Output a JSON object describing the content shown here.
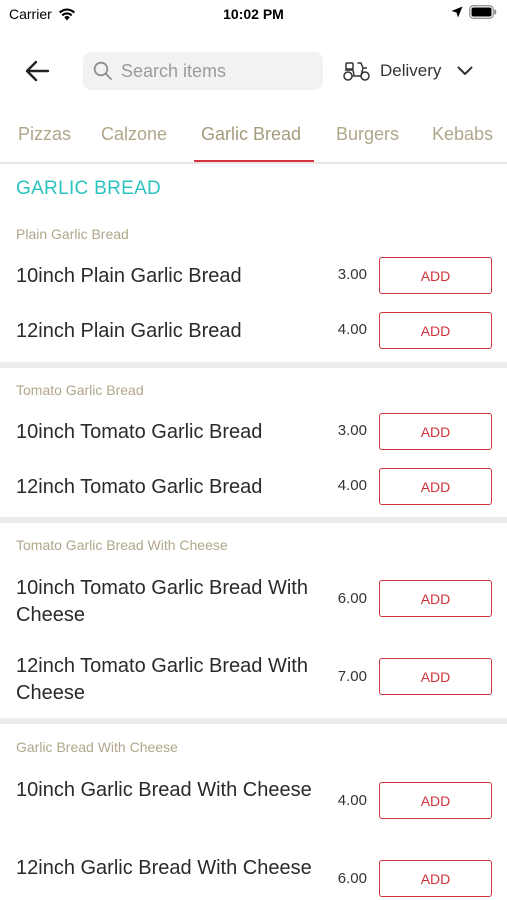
{
  "status_bar": {
    "carrier": "Carrier",
    "time": "10:02 PM"
  },
  "header": {
    "search_placeholder": "Search items",
    "delivery_label": "Delivery"
  },
  "tabs": [
    {
      "label": "Pizzas"
    },
    {
      "label": "Calzone"
    },
    {
      "label": "Garlic Bread",
      "active": true
    },
    {
      "label": "Burgers"
    },
    {
      "label": "Kebabs"
    }
  ],
  "section": {
    "title": "GARLIC BREAD"
  },
  "groups": [
    {
      "title": "Plain Garlic Bread",
      "items": [
        {
          "name": "10inch Plain Garlic Bread",
          "price": "3.00",
          "button": "ADD"
        },
        {
          "name": "12inch Plain Garlic Bread",
          "price": "4.00",
          "button": "ADD"
        }
      ]
    },
    {
      "title": "Tomato Garlic Bread",
      "items": [
        {
          "name": "10inch Tomato Garlic Bread",
          "price": "3.00",
          "button": "ADD"
        },
        {
          "name": "12inch Tomato Garlic Bread",
          "price": "4.00",
          "button": "ADD"
        }
      ]
    },
    {
      "title": "Tomato Garlic Bread With Cheese",
      "items": [
        {
          "name": "10inch Tomato Garlic Bread With Cheese",
          "price": "6.00",
          "button": "ADD"
        },
        {
          "name": "12inch Tomato Garlic Bread With Cheese",
          "price": "7.00",
          "button": "ADD"
        }
      ]
    },
    {
      "title": "Garlic Bread With Cheese",
      "items": [
        {
          "name": "10inch Garlic Bread With Cheese",
          "price": "4.00",
          "button": "ADD"
        },
        {
          "name": "12inch Garlic Bread With Cheese",
          "price": "6.00",
          "button": "ADD"
        }
      ]
    }
  ],
  "colors": {
    "accent": "#d1343c",
    "section_title": "#2bc3bf",
    "group_title": "#b0a68a"
  }
}
